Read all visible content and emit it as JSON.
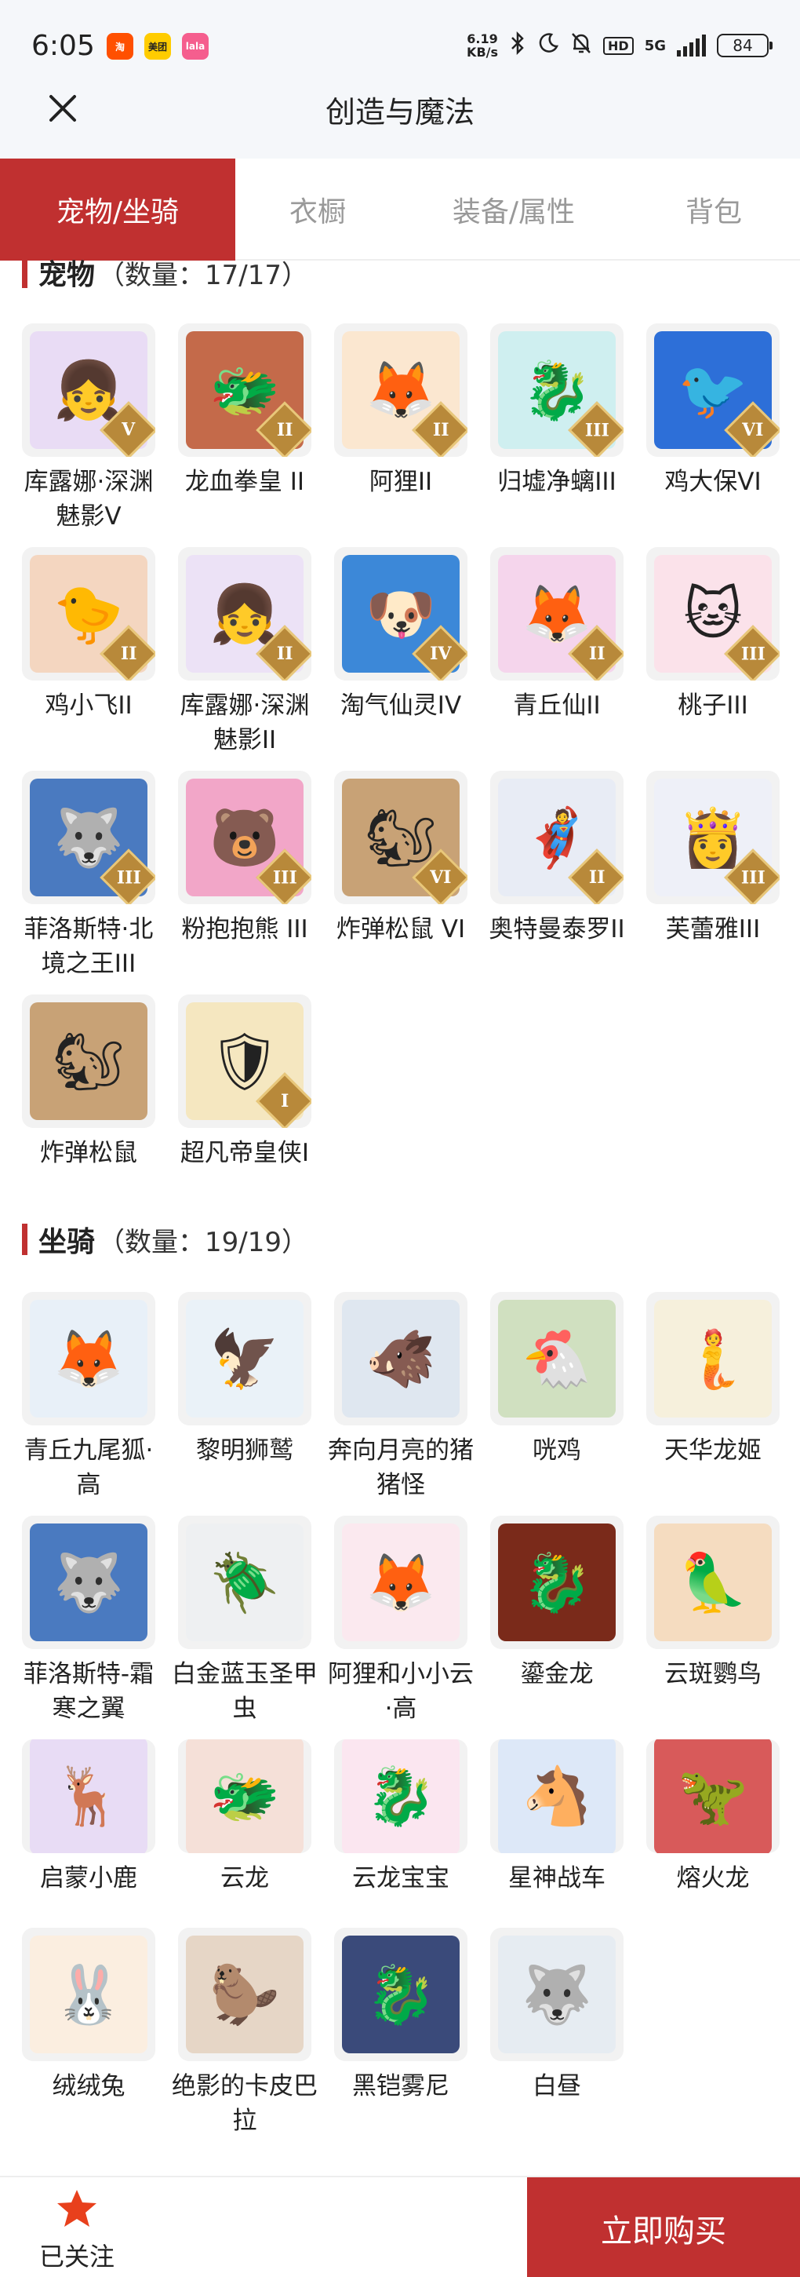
{
  "status_bar": {
    "time": "6:05",
    "apps": [
      {
        "name": "taobao-app-icon",
        "label": "淘",
        "color": "#ff5000"
      },
      {
        "name": "meituan-app-icon",
        "label": "美团",
        "color": "#ffcc00"
      },
      {
        "name": "lianjia-app-icon",
        "label": "lala",
        "color": "#f55e8e"
      }
    ],
    "net_speed": "6.19",
    "net_unit": "KB/s",
    "hd": "HD",
    "network": "5G",
    "battery": "84"
  },
  "header": {
    "title": "创造与魔法",
    "close_icon": "close-icon"
  },
  "tabs": [
    {
      "label": "宠物/坐骑",
      "active": true
    },
    {
      "label": "衣橱",
      "active": false
    },
    {
      "label": "装备/属性",
      "active": false
    },
    {
      "label": "背包",
      "active": false
    }
  ],
  "pets": {
    "title": "宠物",
    "count": "（数量：17/17）",
    "items": [
      {
        "name": "库露娜·深渊魅影V",
        "rank": "V",
        "color": "#e9dcf5",
        "glyph": "👧"
      },
      {
        "name": "龙血拳皇 II",
        "rank": "II",
        "color": "#c46a4a",
        "glyph": "🐲"
      },
      {
        "name": "阿狸II",
        "rank": "II",
        "color": "#fbe7d0",
        "glyph": "🦊"
      },
      {
        "name": "归墟净螭III",
        "rank": "III",
        "color": "#cfeff0",
        "glyph": "🐉"
      },
      {
        "name": "鸡大保VI",
        "rank": "VI",
        "color": "#2d6fd8",
        "glyph": "🐦"
      },
      {
        "name": "鸡小飞II",
        "rank": "II",
        "color": "#f4d6c0",
        "glyph": "🐤"
      },
      {
        "name": "库露娜·深渊魅影II",
        "rank": "II",
        "color": "#ece2f6",
        "glyph": "👧"
      },
      {
        "name": "淘气仙灵IV",
        "rank": "IV",
        "color": "#3c88d8",
        "glyph": "🐶"
      },
      {
        "name": "青丘仙II",
        "rank": "II",
        "color": "#f5d5ec",
        "glyph": "🦊"
      },
      {
        "name": "桃子III",
        "rank": "III",
        "color": "#fbe2ea",
        "glyph": "🐱"
      },
      {
        "name": "菲洛斯特·北境之王III",
        "rank": "III",
        "color": "#4a7ac0",
        "glyph": "🐺"
      },
      {
        "name": "粉抱抱熊 III",
        "rank": "III",
        "color": "#f2a6c8",
        "glyph": "🐻"
      },
      {
        "name": "炸弹松鼠 VI",
        "rank": "VI",
        "color": "#c8a276",
        "glyph": "🐿"
      },
      {
        "name": "奥特曼泰罗II",
        "rank": "II",
        "color": "#e8ecf5",
        "glyph": "🦸"
      },
      {
        "name": "芙蕾雅III",
        "rank": "III",
        "color": "#eef0f8",
        "glyph": "👸"
      },
      {
        "name": "炸弹松鼠",
        "rank": "",
        "color": "#c8a276",
        "glyph": "🐿"
      },
      {
        "name": "超凡帝皇侠I",
        "rank": "I",
        "color": "#f5e7c0",
        "glyph": "🛡"
      }
    ]
  },
  "mounts": {
    "title": "坐骑",
    "count": "（数量：19/19）",
    "items": [
      {
        "name": "青丘九尾狐·高",
        "color": "#e8f0f8",
        "glyph": "🦊"
      },
      {
        "name": "黎明狮鹫",
        "color": "#eaf2f8",
        "glyph": "🦅"
      },
      {
        "name": "奔向月亮的猪猪怪",
        "color": "#dfe7f0",
        "glyph": "🐗"
      },
      {
        "name": "咣鸡",
        "color": "#d0e0c0",
        "glyph": "🐔"
      },
      {
        "name": "天华龙姬",
        "color": "#f6f0dc",
        "glyph": "🧜"
      },
      {
        "name": "菲洛斯特-霜寒之翼",
        "color": "#4a7ac0",
        "glyph": "🐺"
      },
      {
        "name": "白金蓝玉圣甲虫",
        "color": "#eef0f2",
        "glyph": "🪲"
      },
      {
        "name": "阿狸和小小云·高",
        "color": "#fbe9ef",
        "glyph": "🦊"
      },
      {
        "name": "鎏金龙",
        "color": "#7a2a1a",
        "glyph": "🐉"
      },
      {
        "name": "云斑鹦鸟",
        "color": "#f5dcc0",
        "glyph": "🦜"
      },
      {
        "name": "启蒙小鹿",
        "color": "#e8dcf5",
        "glyph": "🦌"
      },
      {
        "name": "云龙",
        "color": "#f5e0d8",
        "glyph": "🐲"
      },
      {
        "name": "云龙宝宝",
        "color": "#fbe6f0",
        "glyph": "🐉"
      },
      {
        "name": "星神战车",
        "color": "#dde8f8",
        "glyph": "🐴"
      },
      {
        "name": "熔火龙",
        "color": "#d85a5a",
        "glyph": "🦖"
      },
      {
        "name": "绒绒兔",
        "color": "#fbeee0",
        "glyph": "🐰"
      },
      {
        "name": "绝影的卡皮巴拉",
        "color": "#e6d6c6",
        "glyph": "🦫"
      },
      {
        "name": "黑铠雾尼",
        "color": "#3a4a7a",
        "glyph": "🐉"
      },
      {
        "name": "白昼",
        "color": "#e6ecf2",
        "glyph": "🐺"
      }
    ]
  },
  "bottom": {
    "follow_label": "已关注",
    "star_icon": "star-icon",
    "buy_label": "立即购买"
  },
  "colors": {
    "accent": "#c03030",
    "star": "#e8401c",
    "rank_badge": "#b8893a"
  }
}
